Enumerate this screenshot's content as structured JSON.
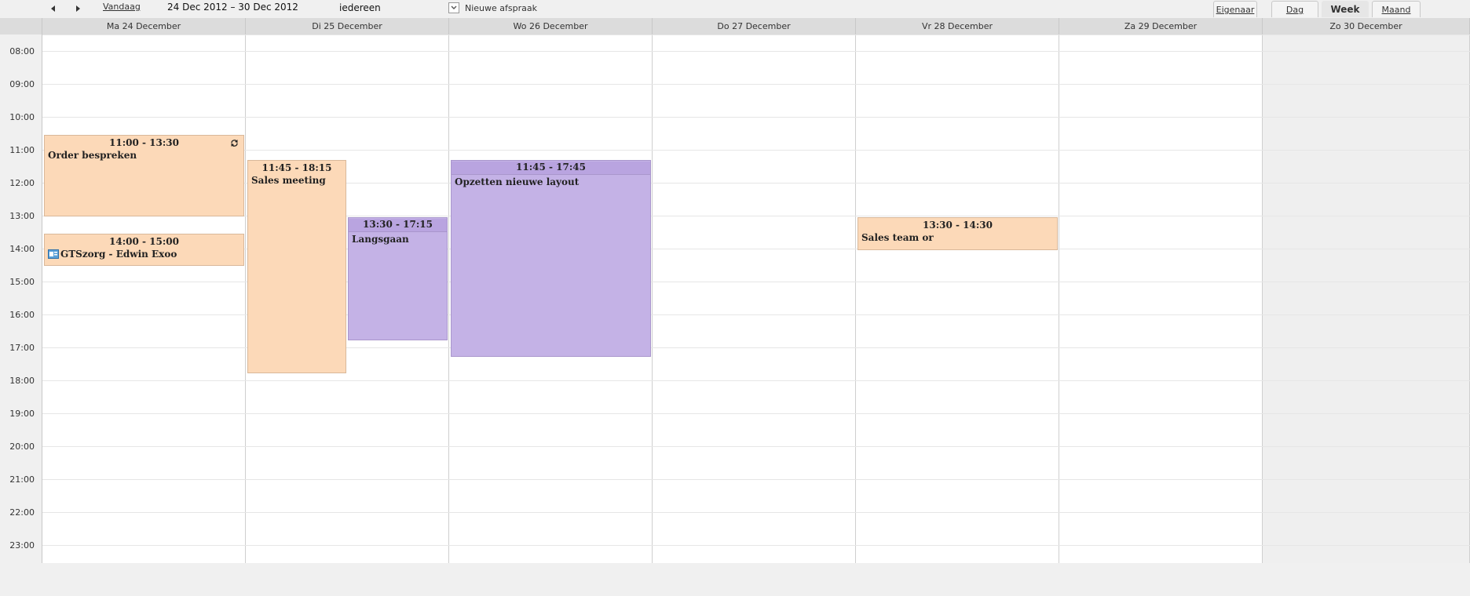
{
  "toolbar": {
    "today_label": "Vandaag",
    "date_range": "24 Dec 2012 – 30 Dec 2012",
    "owner_value": "iedereen",
    "new_appointment_label": "Nieuwe afspraak",
    "owner_tab": "Eigenaar",
    "day_tab": "Dag",
    "week_tab": "Week",
    "month_tab": "Maand",
    "active_view": "Week"
  },
  "days": [
    {
      "label": "Ma 24 December"
    },
    {
      "label": "Di 25 December"
    },
    {
      "label": "Wo 26 December"
    },
    {
      "label": "Do 27 December"
    },
    {
      "label": "Vr 28 December"
    },
    {
      "label": "Za 29 December"
    },
    {
      "label": "Zo 30 December"
    }
  ],
  "hours": [
    "08:00",
    "09:00",
    "10:00",
    "11:00",
    "12:00",
    "13:00",
    "14:00",
    "15:00",
    "16:00",
    "17:00",
    "18:00",
    "19:00",
    "20:00",
    "21:00",
    "22:00",
    "23:00"
  ],
  "events": [
    {
      "time": "11:00 - 13:30",
      "title": "Order bespreken",
      "color": "#fcd9b8",
      "recurring": true
    },
    {
      "time": "14:00 - 15:00",
      "title": "GTSzorg - Edwin Exoo",
      "color": "#fcd9b8",
      "has_icon": true
    },
    {
      "time": "11:45 - 18:15",
      "title": "Sales meeting",
      "color": "#fcd9b8"
    },
    {
      "time": "13:30 - 17:15",
      "title": "Langsgaan",
      "color": "#c4b2e6"
    },
    {
      "time": "11:45 - 17:45",
      "title": "Opzetten nieuwe layout",
      "color": "#c4b2e6"
    },
    {
      "time": "13:30 - 14:30",
      "title": "Sales team or",
      "color": "#fcd9b8"
    }
  ]
}
